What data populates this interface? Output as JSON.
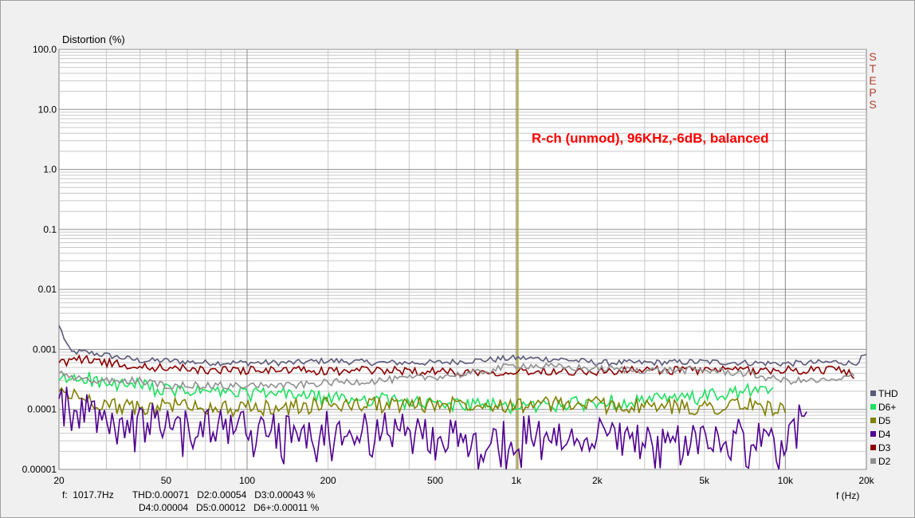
{
  "chart_data": {
    "type": "line",
    "ylabel": "Distortion (%)",
    "xlabel": "f (Hz)",
    "x_scale": "log",
    "y_scale": "log",
    "xlim": [
      20,
      20000
    ],
    "ylim": [
      1e-05,
      100
    ],
    "grid": true,
    "legend_position": "bottom-right",
    "x_ticks": [
      {
        "value": 20,
        "label": "20"
      },
      {
        "value": 50,
        "label": "50"
      },
      {
        "value": 100,
        "label": "100"
      },
      {
        "value": 200,
        "label": "200"
      },
      {
        "value": 500,
        "label": "500"
      },
      {
        "value": 1000,
        "label": "1k"
      },
      {
        "value": 2000,
        "label": "2k"
      },
      {
        "value": 5000,
        "label": "5k"
      },
      {
        "value": 10000,
        "label": "10k"
      },
      {
        "value": 20000,
        "label": "20k"
      }
    ],
    "y_ticks": [
      {
        "value": 100,
        "label": "100.0"
      },
      {
        "value": 10,
        "label": "10.0"
      },
      {
        "value": 1,
        "label": "1.0"
      },
      {
        "value": 0.1,
        "label": "0.1"
      },
      {
        "value": 0.01,
        "label": "0.01"
      },
      {
        "value": 0.001,
        "label": "0.001"
      },
      {
        "value": 0.0001,
        "label": "0.0001"
      },
      {
        "value": 1e-05,
        "label": "0.00001"
      }
    ],
    "annotation": "R-ch (unmod), 96KHz,-6dB, balanced",
    "side_label": [
      "S",
      "T",
      "E",
      "P",
      "S"
    ],
    "cursor_frequency": 1017.7,
    "series": [
      {
        "name": "THD",
        "color": "#5a5a7a",
        "x": [
          20,
          22,
          25,
          30,
          40,
          50,
          70,
          100,
          150,
          200,
          300,
          500,
          700,
          1000,
          1500,
          2000,
          3000,
          5000,
          7000,
          10000,
          13000,
          16000,
          18000,
          20000
        ],
        "y": [
          0.0025,
          0.0009,
          0.0009,
          0.0008,
          0.00065,
          0.00065,
          0.0006,
          0.0006,
          0.0006,
          0.00065,
          0.0006,
          0.0006,
          0.00065,
          0.00072,
          0.00068,
          0.0006,
          0.0006,
          0.00062,
          0.0006,
          0.00058,
          0.0006,
          0.00062,
          0.00058,
          0.0008
        ]
      },
      {
        "name": "D6+",
        "color": "#20e060",
        "x": [
          20,
          25,
          30,
          40,
          50,
          70,
          100,
          150,
          200,
          300,
          500,
          700,
          1000,
          1500,
          2000,
          3000,
          5000,
          7000,
          9000
        ],
        "y": [
          0.0003,
          0.00035,
          0.00025,
          0.00025,
          0.0002,
          0.0002,
          0.00018,
          0.00018,
          0.00015,
          0.00015,
          0.00012,
          0.00012,
          0.00011,
          0.00012,
          0.00013,
          0.00014,
          0.00016,
          0.0002,
          0.0002
        ]
      },
      {
        "name": "D5",
        "color": "#808000",
        "x": [
          20,
          25,
          30,
          40,
          50,
          70,
          100,
          150,
          200,
          300,
          500,
          700,
          1000,
          1500,
          2000,
          3000,
          5000,
          7000,
          10000
        ],
        "y": [
          0.0002,
          0.00015,
          0.00012,
          0.0001,
          0.00012,
          0.00011,
          0.0001,
          0.00011,
          0.00012,
          0.00012,
          0.00012,
          0.00013,
          0.00012,
          0.00012,
          0.00012,
          0.00011,
          0.00011,
          0.00012,
          0.0001
        ]
      },
      {
        "name": "D4",
        "color": "#500090",
        "x": [
          20,
          25,
          30,
          40,
          50,
          70,
          100,
          150,
          200,
          300,
          500,
          700,
          1000,
          1500,
          2000,
          3000,
          5000,
          7000,
          10000,
          12000
        ],
        "y": [
          0.00015,
          0.0001,
          5e-05,
          7e-05,
          6e-05,
          5e-05,
          5e-05,
          4e-05,
          5e-05,
          5e-05,
          4e-05,
          3e-05,
          4e-05,
          4e-05,
          4e-05,
          3e-05,
          3e-05,
          4e-05,
          3e-05,
          0.0001
        ]
      },
      {
        "name": "D3",
        "color": "#8b0000",
        "x": [
          20,
          25,
          30,
          40,
          50,
          70,
          100,
          150,
          200,
          300,
          500,
          700,
          1000,
          1500,
          2000,
          3000,
          5000,
          7000,
          10000,
          13000,
          16000,
          18000
        ],
        "y": [
          0.0006,
          0.0007,
          0.0006,
          0.0005,
          0.0005,
          0.00045,
          0.00045,
          0.00045,
          0.00043,
          0.00045,
          0.00043,
          0.00042,
          0.00043,
          0.00044,
          0.00042,
          0.00045,
          0.00045,
          0.00045,
          0.00045,
          0.00045,
          0.00048,
          0.00035
        ]
      },
      {
        "name": "D2",
        "color": "#909090",
        "x": [
          20,
          25,
          30,
          40,
          50,
          70,
          100,
          150,
          200,
          300,
          500,
          700,
          1000,
          1500,
          2000,
          3000,
          5000,
          7000,
          10000,
          13000,
          16000,
          18000
        ],
        "y": [
          0.0004,
          0.0003,
          0.0003,
          0.0003,
          0.00025,
          0.00025,
          0.00025,
          0.00025,
          0.00028,
          0.0003,
          0.00035,
          0.0004,
          0.00055,
          0.0005,
          0.00048,
          0.00045,
          0.00045,
          0.0004,
          0.0003,
          0.0003,
          0.0003,
          0.0004
        ]
      }
    ]
  },
  "readout": {
    "line1": "f:  1017.7Hz       THD:0.00071   D2:0.00054   D3:0.00043 %",
    "line2": "D4:0.00004   D5:0.00012   D6+:0.00011 %"
  }
}
